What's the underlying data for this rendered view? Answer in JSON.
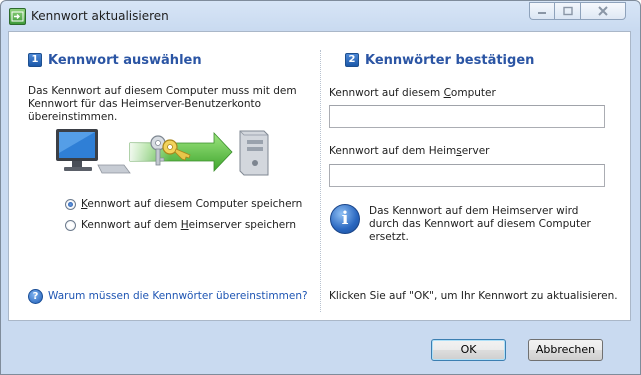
{
  "window": {
    "title": "Kennwort aktualisieren"
  },
  "left": {
    "step_number": "1",
    "heading": "Kennwort auswählen",
    "description": "Das Kennwort auf diesem Computer muss mit dem Kennwort für das Heimserver-Benutzerkonto übereinstimmen.",
    "options": [
      {
        "pre": "",
        "mnemonic": "K",
        "post": "ennwort auf diesem Computer speichern",
        "checked": true
      },
      {
        "pre": "Kennwort auf dem ",
        "mnemonic": "H",
        "post": "eimserver speichern",
        "checked": false
      }
    ],
    "help_link": "Warum müssen die Kennwörter übereinstimmen?"
  },
  "right": {
    "step_number": "2",
    "heading": "Kennwörter bestätigen",
    "field1": {
      "pre": "Kennwort auf diesem ",
      "mnemonic": "C",
      "post": "omputer",
      "value": ""
    },
    "field2": {
      "pre": "Kennwort auf dem Heim",
      "mnemonic": "s",
      "post": "erver",
      "value": ""
    },
    "info_text": "Das Kennwort auf dem Heimserver wird durch das Kennwort auf diesem Computer ersetzt.",
    "footer_text": "Klicken Sie auf \"OK\", um Ihr Kennwort zu aktualisieren."
  },
  "buttons": {
    "ok": "OK",
    "cancel": "Abbrechen"
  },
  "icons": {
    "app": "green-arrow-window-icon",
    "info": "info-icon",
    "help": "help-icon"
  },
  "colors": {
    "heading": "#2b55a4",
    "link": "#1e55b3",
    "frame": "#c9daf0"
  }
}
